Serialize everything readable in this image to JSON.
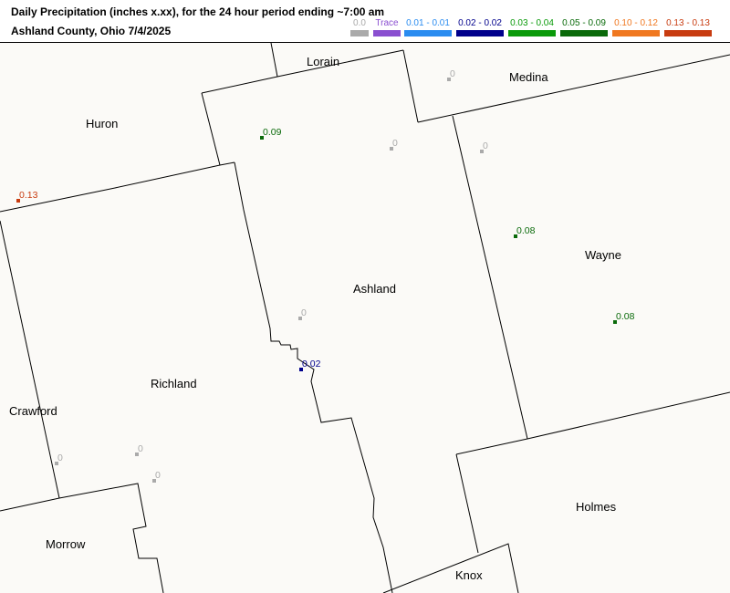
{
  "header": {
    "title_line1": "Daily Precipitation (inches  x.xx),  for the 24 hour period ending ~7:00 am",
    "title_line2": "Ashland County, Ohio  7/4/2025"
  },
  "legend": [
    {
      "label": "0.0",
      "color": "#aaaaaa"
    },
    {
      "label": "Trace",
      "color": "#8a4fd0"
    },
    {
      "label": "0.01 - 0.01",
      "color": "#2a8cf0"
    },
    {
      "label": "0.02 - 0.02",
      "color": "#00008c"
    },
    {
      "label": "0.03 - 0.04",
      "color": "#0a9a0a"
    },
    {
      "label": "0.05 - 0.09",
      "color": "#0a6a0a"
    },
    {
      "label": "0.10 - 0.12",
      "color": "#f07820"
    },
    {
      "label": "0.13 - 0.13",
      "color": "#c83c10"
    }
  ],
  "counties": [
    "Lorain",
    "Medina",
    "Huron",
    "Ashland",
    "Wayne",
    "Richland",
    "Crawford",
    "Holmes",
    "Morrow",
    "Knox"
  ],
  "stations": [
    {
      "value": "0.09",
      "color": "#0a6a0a"
    },
    {
      "value": "0.13",
      "color": "#c83c10"
    },
    {
      "value": "0.08",
      "color": "#0a6a0a"
    },
    {
      "value": "0.08",
      "color": "#0a6a0a"
    },
    {
      "value": "0.02",
      "color": "#00008c"
    },
    {
      "value": "0",
      "color": "#aaaaaa"
    },
    {
      "value": "0",
      "color": "#aaaaaa"
    },
    {
      "value": "0",
      "color": "#aaaaaa"
    },
    {
      "value": "0",
      "color": "#aaaaaa"
    },
    {
      "value": "0",
      "color": "#aaaaaa"
    },
    {
      "value": "0",
      "color": "#aaaaaa"
    },
    {
      "value": "0",
      "color": "#aaaaaa"
    }
  ]
}
